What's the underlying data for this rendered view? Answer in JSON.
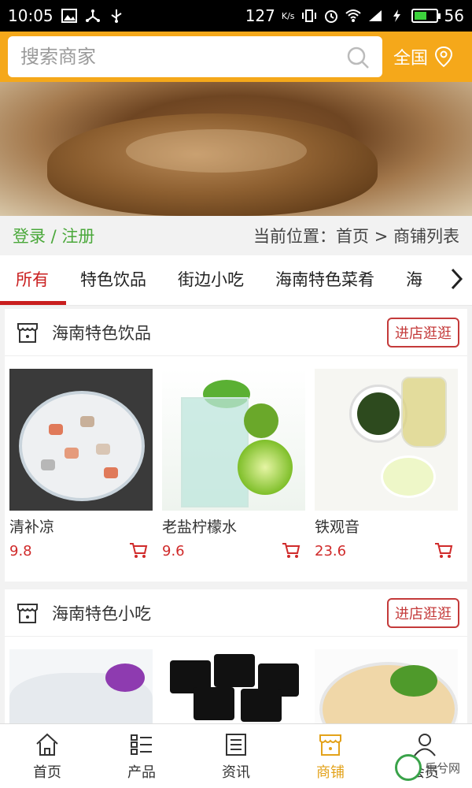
{
  "status_bar": {
    "time": "10:05",
    "speed": "127",
    "speed_unit": "K/s",
    "battery": "56",
    "battery_level": 0.56
  },
  "search": {
    "placeholder": "搜索商家",
    "region_label": "全国"
  },
  "account": {
    "login_register": "登录 / 注册"
  },
  "breadcrumb": {
    "text": "当前位置：首页 > 商铺列表"
  },
  "tabs": [
    {
      "label": "所有",
      "active": true
    },
    {
      "label": "特色饮品",
      "active": false
    },
    {
      "label": "街边小吃",
      "active": false
    },
    {
      "label": "海南特色菜肴",
      "active": false
    },
    {
      "label": "海",
      "active": false
    }
  ],
  "stores": [
    {
      "name": "海南特色饮品",
      "visit_label": "进店逛逛",
      "products": [
        {
          "name": "清补凉",
          "price": "9.8"
        },
        {
          "name": "老盐柠檬水",
          "price": "9.6"
        },
        {
          "name": "铁观音",
          "price": "23.6"
        }
      ]
    },
    {
      "name": "海南特色小吃",
      "visit_label": "进店逛逛",
      "products": [
        {
          "name": "",
          "price": ""
        },
        {
          "name": "",
          "price": ""
        },
        {
          "name": "",
          "price": ""
        }
      ]
    }
  ],
  "bottom_nav": [
    {
      "label": "首页",
      "icon": "home-icon",
      "active": false
    },
    {
      "label": "产品",
      "icon": "list-icon",
      "active": false
    },
    {
      "label": "资讯",
      "icon": "news-icon",
      "active": false
    },
    {
      "label": "商铺",
      "icon": "store-icon",
      "active": true
    },
    {
      "label": "会员",
      "icon": "user-icon",
      "active": false
    }
  ],
  "watermark": {
    "text": "乐兮网"
  },
  "colors": {
    "brand": "#f5a81a",
    "accent_red": "#c91e1e",
    "login_green": "#4aa83a",
    "active_nav": "#e3a21a"
  }
}
